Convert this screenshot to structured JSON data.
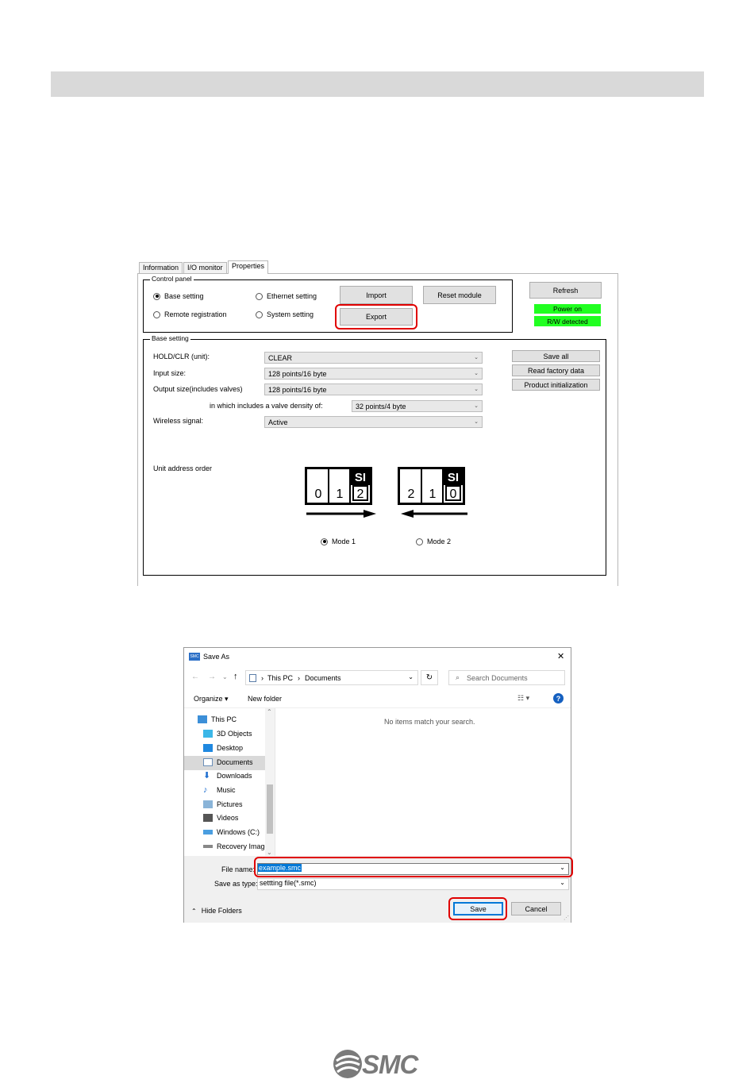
{
  "properties_window": {
    "tabs": [
      "Information",
      "I/O monitor",
      "Properties"
    ],
    "control_panel": {
      "title": "Control panel",
      "radios": {
        "base_setting": "Base setting",
        "ethernet_setting": "Ethernet setting",
        "remote_registration": "Remote registration",
        "system_setting": "System setting"
      },
      "buttons": {
        "import": "Import",
        "reset_module": "Reset module",
        "export": "Export",
        "refresh": "Refresh"
      },
      "status": {
        "power": "Power on",
        "rw": "R/W detected"
      }
    },
    "base_setting": {
      "title": "Base setting",
      "fields": [
        {
          "label": "HOLD/CLR (unit):",
          "value": "CLEAR"
        },
        {
          "label": "Input size:",
          "value": "128 points/16 byte"
        },
        {
          "label": "Output size(includes valves)",
          "value": "128 points/16 byte"
        },
        {
          "label": "in which includes a valve density of:",
          "value": "32 points/4 byte"
        },
        {
          "label": "Wireless signal:",
          "value": "Active"
        }
      ],
      "buttons": {
        "save_all": "Save all",
        "read_factory": "Read factory data",
        "product_init": "Product initialization"
      },
      "unit_address_label": "Unit address order",
      "mode1": {
        "si": "SI",
        "digits": [
          "0",
          "1",
          "2"
        ],
        "label": "Mode 1",
        "selected": true
      },
      "mode2": {
        "si": "SI",
        "digits": [
          "2",
          "1",
          "0"
        ],
        "label": "Mode 2",
        "selected": false
      }
    }
  },
  "save_dialog": {
    "title": "Save As",
    "close": "✕",
    "breadcrumb": [
      "This PC",
      "Documents"
    ],
    "search_placeholder": "Search Documents",
    "organize": "Organize ▾",
    "new_folder": "New folder",
    "empty_message": "No items match your search.",
    "tree": [
      {
        "label": "This PC",
        "icon": "computer-icon"
      },
      {
        "label": "3D Objects",
        "icon": "cube-icon"
      },
      {
        "label": "Desktop",
        "icon": "desktop-icon"
      },
      {
        "label": "Documents",
        "icon": "document-icon",
        "selected": true
      },
      {
        "label": "Downloads",
        "icon": "download-icon"
      },
      {
        "label": "Music",
        "icon": "music-icon"
      },
      {
        "label": "Pictures",
        "icon": "picture-icon"
      },
      {
        "label": "Videos",
        "icon": "video-icon"
      },
      {
        "label": "Windows (C:)",
        "icon": "drive-icon"
      },
      {
        "label": "Recovery Image",
        "icon": "drive-icon"
      }
    ],
    "file_name_label": "File name:",
    "file_name_value": "example.smc",
    "save_type_label": "Save as type:",
    "save_type_value": "settting file(*.smc)",
    "hide_folders": "Hide Folders",
    "save": "Save",
    "cancel": "Cancel"
  },
  "footer_logo": "SMC"
}
